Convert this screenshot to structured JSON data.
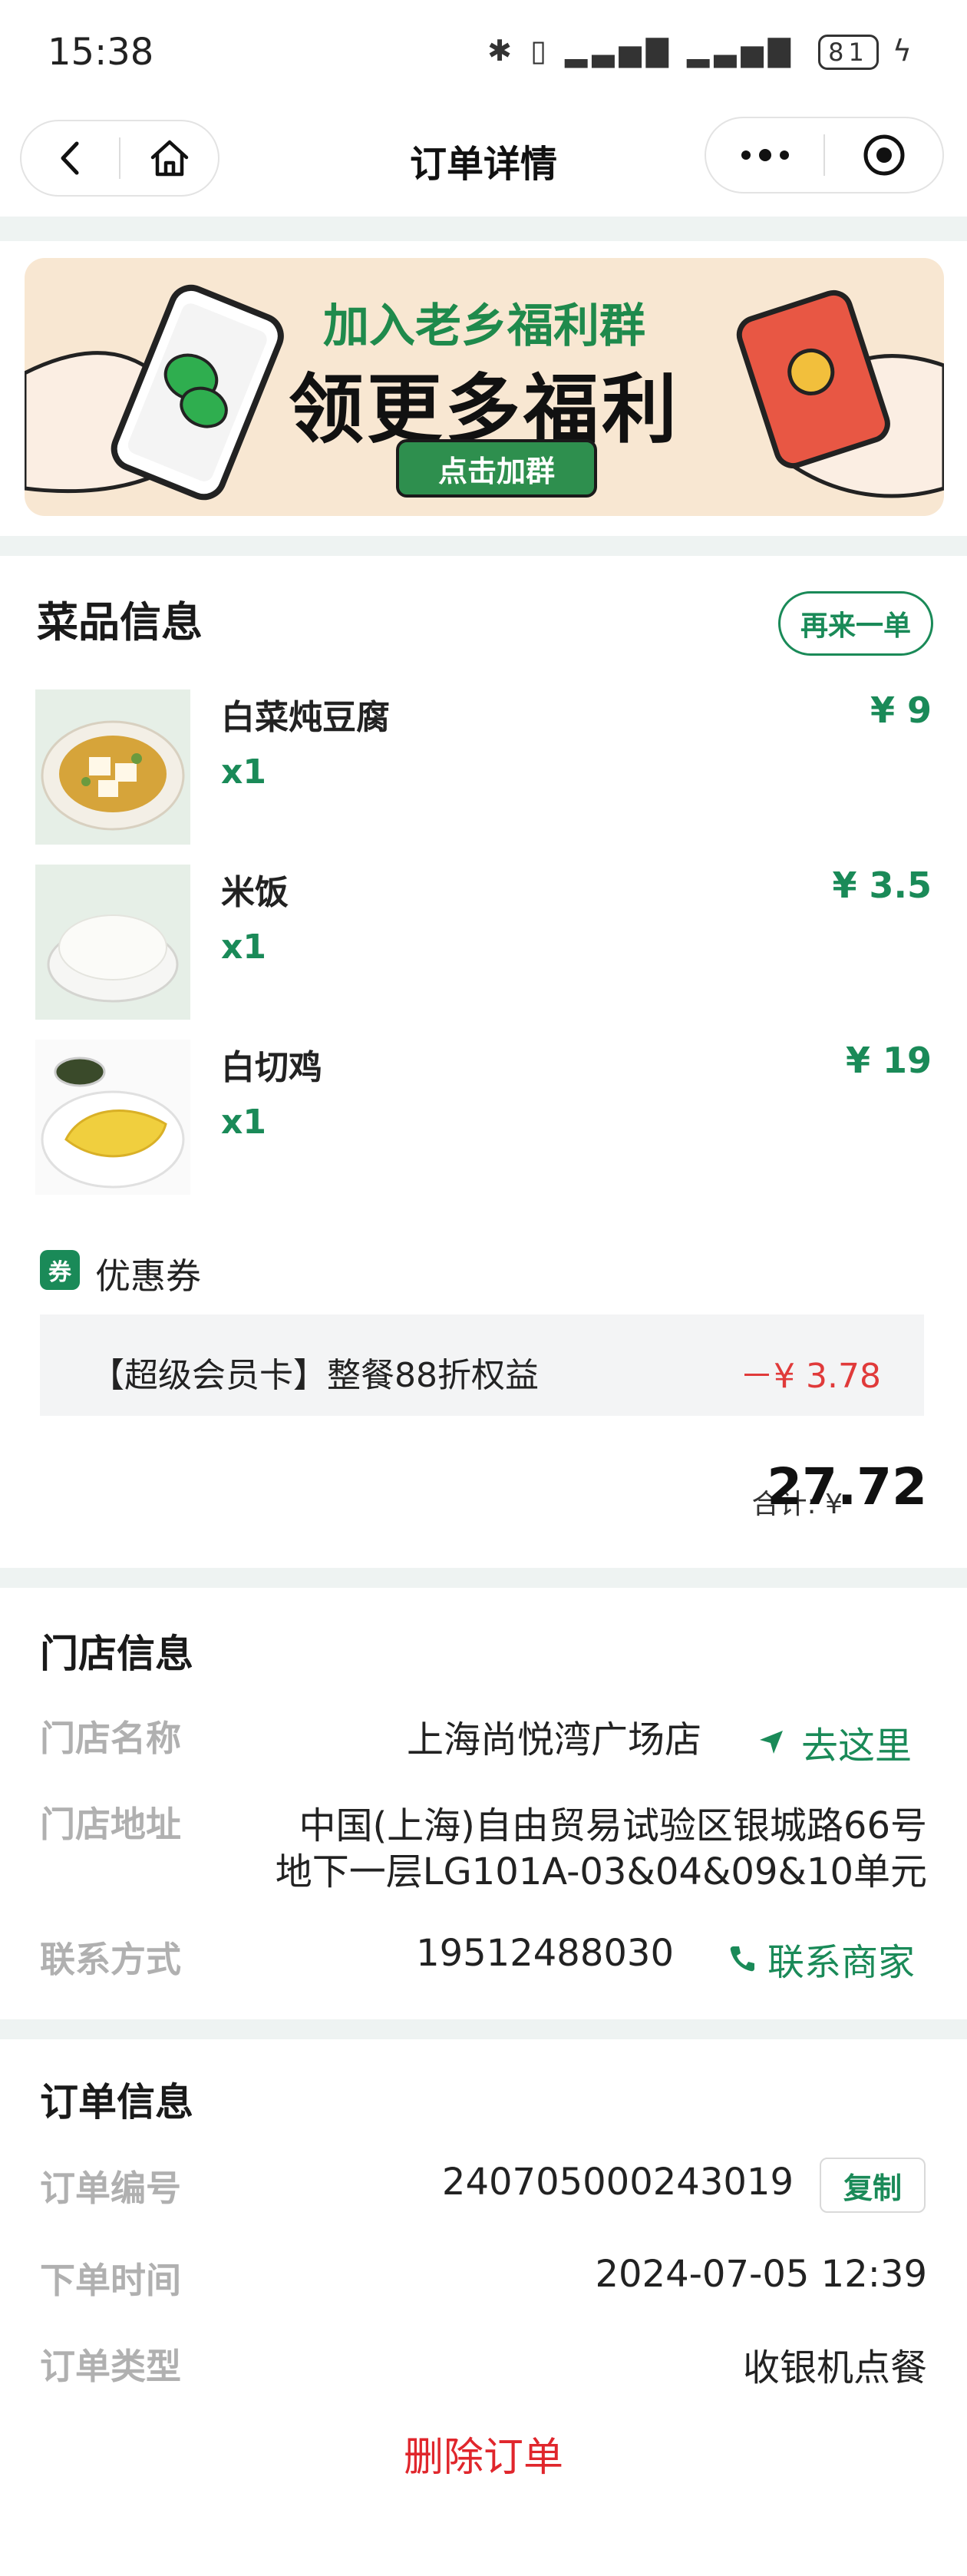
{
  "status": {
    "time": "15:38",
    "battery": "81"
  },
  "nav": {
    "title": "订单详情"
  },
  "banner": {
    "subtitle": "加入老乡福利群",
    "headline": "领更多福利",
    "button": "点击加群"
  },
  "dishes_section": {
    "title": "菜品信息",
    "reorder_button": "再来一单",
    "items": [
      {
        "name": "白菜炖豆腐",
        "qty": "x1",
        "price": "¥ 9"
      },
      {
        "name": "米饭",
        "qty": "x1",
        "price": "¥ 3.5"
      },
      {
        "name": "白切鸡",
        "qty": "x1",
        "price": "¥ 19"
      }
    ],
    "coupon": {
      "tag": "券",
      "label": "优惠券",
      "name": "【超级会员卡】整餐88折权益",
      "amount": "－¥ 3.78"
    },
    "total": {
      "label": "合计: ¥",
      "value": "27.72"
    }
  },
  "store": {
    "title": "门店信息",
    "name_label": "门店名称",
    "name": "上海尚悦湾广场店",
    "navigate": "去这里",
    "address_label": "门店地址",
    "address_line1": "中国(上海)自由贸易试验区银城路66号",
    "address_line2": "地下一层LG101A-03&04&09&10单元",
    "contact_label": "联系方式",
    "phone": "19512488030",
    "contact_link": "联系商家"
  },
  "order": {
    "title": "订单信息",
    "number_label": "订单编号",
    "number": "240705000243019",
    "copy": "复制",
    "time_label": "下单时间",
    "time": "2024-07-05 12:39",
    "type_label": "订单类型",
    "type": "收银机点餐",
    "delete": "删除订单"
  },
  "colors": {
    "accent": "#1a8a58",
    "danger": "#e0262c",
    "discount": "#e03a3a"
  }
}
